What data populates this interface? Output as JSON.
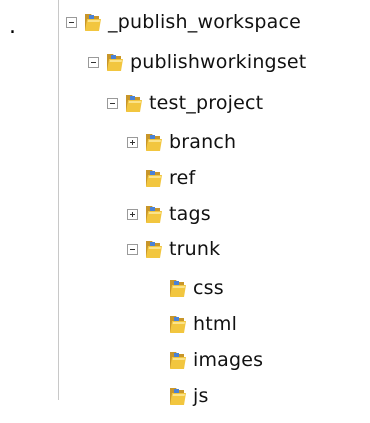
{
  "marker": ".",
  "tree": {
    "nodes": [
      {
        "id": "publish-workspace",
        "label": "_publish_workspace",
        "state": "expanded",
        "icon": "folder-icon"
      },
      {
        "id": "publishworkingset",
        "label": "publishworkingset",
        "state": "expanded",
        "icon": "folder-icon"
      },
      {
        "id": "test-project",
        "label": "test_project",
        "state": "expanded",
        "icon": "folder-icon"
      },
      {
        "id": "branch",
        "label": "branch",
        "state": "collapsed",
        "icon": "folder-icon"
      },
      {
        "id": "ref",
        "label": "ref",
        "state": "leaf",
        "icon": "folder-icon"
      },
      {
        "id": "tags",
        "label": "tags",
        "state": "collapsed",
        "icon": "folder-icon"
      },
      {
        "id": "trunk",
        "label": "trunk",
        "state": "expanded",
        "icon": "folder-icon"
      },
      {
        "id": "css",
        "label": "css",
        "state": "leaf",
        "icon": "folder-icon"
      },
      {
        "id": "html",
        "label": "html",
        "state": "leaf",
        "icon": "folder-icon"
      },
      {
        "id": "images",
        "label": "images",
        "state": "leaf",
        "icon": "folder-icon"
      },
      {
        "id": "js",
        "label": "js",
        "state": "leaf",
        "icon": "folder-icon"
      }
    ]
  },
  "colors": {
    "folder_main": "#f2c63f",
    "folder_dark": "#c8962a",
    "folder_light": "#fbe38a",
    "folder_blue": "#4a82d6",
    "toggle_border": "#9a9a9a"
  }
}
